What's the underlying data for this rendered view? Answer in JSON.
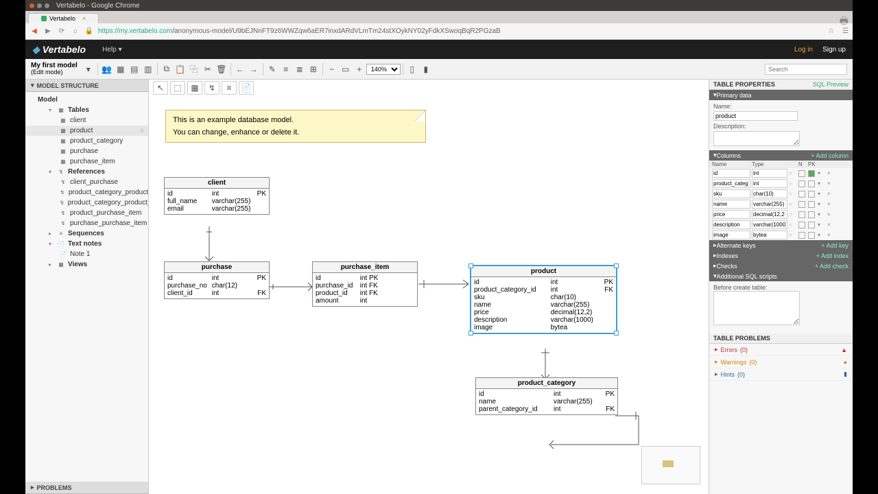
{
  "window": {
    "title": "Vertabelo - Google Chrome"
  },
  "tab": {
    "label": "Vertabelo"
  },
  "url": {
    "host": "https://my.vertabelo.com",
    "path": "/anonymous-model/U9bEJNnFT9z6WWZqw6aER7inxdARdVLmTm24stXOykNY02yFdkXSwoqBqR2PGzaB"
  },
  "brand": "Vertabelo",
  "help": "Help",
  "auth": {
    "login": "Log in",
    "signup": "Sign up"
  },
  "model": {
    "name": "My first model",
    "mode": "(Edit mode)"
  },
  "zoom": "140%",
  "search_ph": "Search",
  "left": {
    "hdr": "MODEL STRUCTURE",
    "root": "Model",
    "groups": {
      "tables": "Tables",
      "references": "References",
      "sequences": "Sequences",
      "textnotes": "Text notes",
      "views": "Views"
    },
    "tables": [
      "client",
      "product",
      "product_category",
      "purchase",
      "purchase_item"
    ],
    "refs": [
      "client_purchase",
      "product_category_product",
      "product_category_product_cat...",
      "product_purchase_item",
      "purchase_purchase_item"
    ],
    "notes": [
      "Note 1"
    ],
    "problems": "PROBLEMS"
  },
  "note": {
    "l1": "This is an example database model.",
    "l2": "You can change, enhance or delete it."
  },
  "erd": {
    "client": {
      "title": "client",
      "cols": [
        [
          "id",
          "int",
          "PK"
        ],
        [
          "full_name",
          "varchar(255)",
          ""
        ],
        [
          "email",
          "varchar(255)",
          ""
        ]
      ]
    },
    "purchase": {
      "title": "purchase",
      "cols": [
        [
          "id",
          "int",
          "PK"
        ],
        [
          "purchase_no",
          "char(12)",
          ""
        ],
        [
          "client_id",
          "int",
          "FK"
        ]
      ]
    },
    "purchase_item": {
      "title": "purchase_item",
      "cols": [
        [
          "id",
          "int PK",
          ""
        ],
        [
          "purchase_id",
          "int FK",
          ""
        ],
        [
          "product_id",
          "int FK",
          ""
        ],
        [
          "amount",
          "int",
          ""
        ]
      ]
    },
    "product": {
      "title": "product",
      "cols": [
        [
          "id",
          "int",
          "PK"
        ],
        [
          "product_category_id",
          "int",
          "FK"
        ],
        [
          "sku",
          "char(10)",
          ""
        ],
        [
          "name",
          "varchar(255)",
          ""
        ],
        [
          "price",
          "decimal(12,2)",
          ""
        ],
        [
          "description",
          "varchar(1000)",
          ""
        ],
        [
          "image",
          "bytea",
          ""
        ]
      ]
    },
    "product_category": {
      "title": "product_category",
      "cols": [
        [
          "id",
          "int",
          "PK"
        ],
        [
          "name",
          "varchar(255)",
          ""
        ],
        [
          "parent_category_id",
          "int",
          "FK"
        ]
      ]
    }
  },
  "rp": {
    "hdr": "TABLE PROPERTIES",
    "sql": "SQL Preview",
    "primary": {
      "hdr": "Primary data",
      "name_lbl": "Name:",
      "name_val": "product",
      "desc_lbl": "Description:"
    },
    "columns": {
      "hdr": "Columns",
      "add": "+ Add column",
      "h": {
        "name": "Name",
        "type": "Type",
        "n": "N",
        "pk": "PK"
      },
      "rows": [
        {
          "name": "id",
          "type": "int",
          "n": false,
          "pk": true
        },
        {
          "name": "product_categ",
          "type": "int",
          "n": false,
          "pk": false
        },
        {
          "name": "sku",
          "type": "char(10)",
          "n": false,
          "pk": false
        },
        {
          "name": "name",
          "type": "varchar(255)",
          "n": false,
          "pk": false
        },
        {
          "name": "price",
          "type": "decimal(12,2",
          "n": false,
          "pk": false
        },
        {
          "name": "description",
          "type": "varchar(1000)",
          "n": false,
          "pk": false
        },
        {
          "name": "image",
          "type": "bytea",
          "n": false,
          "pk": false
        }
      ]
    },
    "altkeys": {
      "hdr": "Alternate keys",
      "add": "+ Add key"
    },
    "indexes": {
      "hdr": "Indexes",
      "add": "+ Add index"
    },
    "checks": {
      "hdr": "Checks",
      "add": "+ Add check"
    },
    "sqlscr": {
      "hdr": "Additional SQL scripts",
      "lbl": "Before create table:"
    },
    "problems": {
      "hdr": "TABLE PROBLEMS",
      "err": "Errors",
      "wrn": "Warnings",
      "hnt": "Hints",
      "zero": "(0)"
    }
  }
}
